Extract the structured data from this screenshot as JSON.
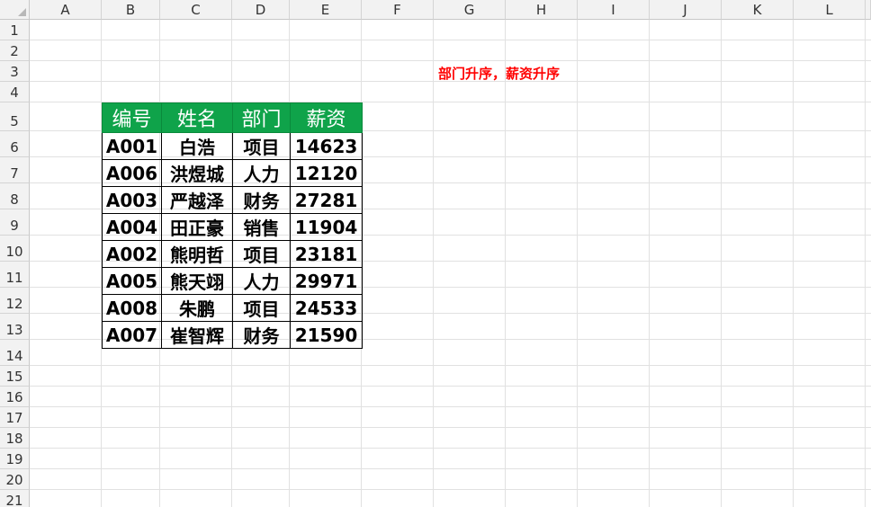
{
  "columns": [
    "A",
    "B",
    "C",
    "D",
    "E",
    "F",
    "G",
    "H",
    "I",
    "J",
    "K",
    "L"
  ],
  "rows": [
    "1",
    "2",
    "3",
    "4",
    "5",
    "6",
    "7",
    "8",
    "9",
    "10",
    "11",
    "12",
    "13",
    "14",
    "15",
    "16",
    "17",
    "18",
    "19",
    "20",
    "21"
  ],
  "note": "部门升序，薪资升序",
  "table": {
    "headers": [
      "编号",
      "姓名",
      "部门",
      "薪资"
    ],
    "rows": [
      [
        "A001",
        "白浩",
        "项目",
        "14623"
      ],
      [
        "A006",
        "洪煜城",
        "人力",
        "12120"
      ],
      [
        "A003",
        "严越泽",
        "财务",
        "27281"
      ],
      [
        "A004",
        "田正豪",
        "销售",
        "11904"
      ],
      [
        "A002",
        "熊明哲",
        "项目",
        "23181"
      ],
      [
        "A005",
        "熊天翊",
        "人力",
        "29971"
      ],
      [
        "A008",
        "朱鹏",
        "项目",
        "24533"
      ],
      [
        "A007",
        "崔智辉",
        "财务",
        "21590"
      ]
    ]
  },
  "colors": {
    "header_bg": "#0fa34a",
    "header_text": "#ffffff",
    "note_text": "#ff0000"
  }
}
